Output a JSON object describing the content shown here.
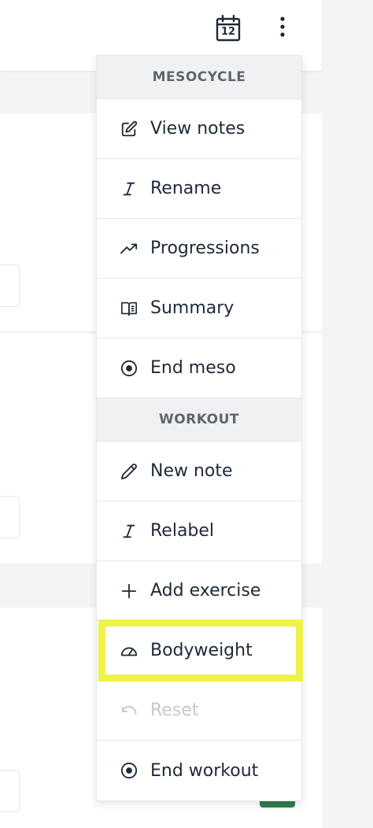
{
  "toolbar": {
    "calendar_day": "12",
    "calendar_icon": "calendar-icon",
    "more_icon": "more-vertical-icon"
  },
  "menu": {
    "section_mesocycle": "MESOCYCLE",
    "section_workout": "WORKOUT",
    "items": [
      {
        "label": "View notes",
        "icon": "edit-note-icon"
      },
      {
        "label": "Rename",
        "icon": "italic-cursor-icon"
      },
      {
        "label": "Progressions",
        "icon": "trending-up-icon"
      },
      {
        "label": "Summary",
        "icon": "book-open-icon"
      },
      {
        "label": "End meso",
        "icon": "stop-circle-icon"
      },
      {
        "label": "New note",
        "icon": "pencil-icon"
      },
      {
        "label": "Relabel",
        "icon": "italic-cursor-icon"
      },
      {
        "label": "Add exercise",
        "icon": "plus-icon"
      },
      {
        "label": "Bodyweight",
        "icon": "gauge-icon"
      },
      {
        "label": "Reset",
        "icon": "undo-icon"
      },
      {
        "label": "End workout",
        "icon": "stop-circle-icon"
      }
    ]
  },
  "colors": {
    "highlight": "#eef24a",
    "accent_green": "#2f7d4f",
    "disabled_text": "#c4c7cc"
  }
}
